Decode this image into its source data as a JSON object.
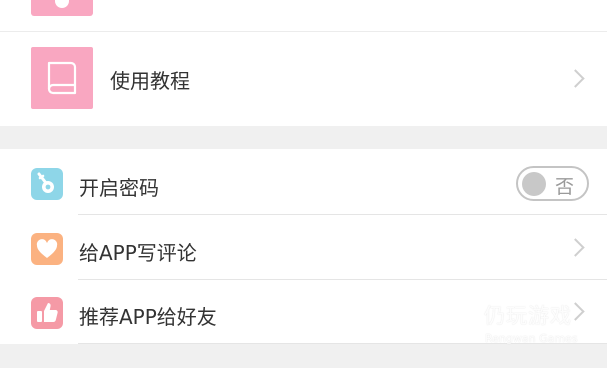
{
  "settings_top": {
    "tutorial": {
      "label": "使用教程",
      "icon": "book-icon"
    }
  },
  "settings": {
    "password": {
      "label": "开启密码",
      "icon": "key-icon",
      "toggle_text": "否",
      "enabled": false
    },
    "review": {
      "label": "给APP写评论",
      "icon": "heart-icon"
    },
    "recommend": {
      "label": "推荐APP给好友",
      "icon": "thumbs-up-icon"
    }
  },
  "watermark": {
    "title": "仍玩游戏",
    "subtitle": "Rengwan Games"
  },
  "colors": {
    "pink": "#f9a7c1",
    "cyan": "#8ed6e8",
    "orange": "#fbb281",
    "coral": "#f59aa6",
    "background": "#f0f0f0"
  }
}
